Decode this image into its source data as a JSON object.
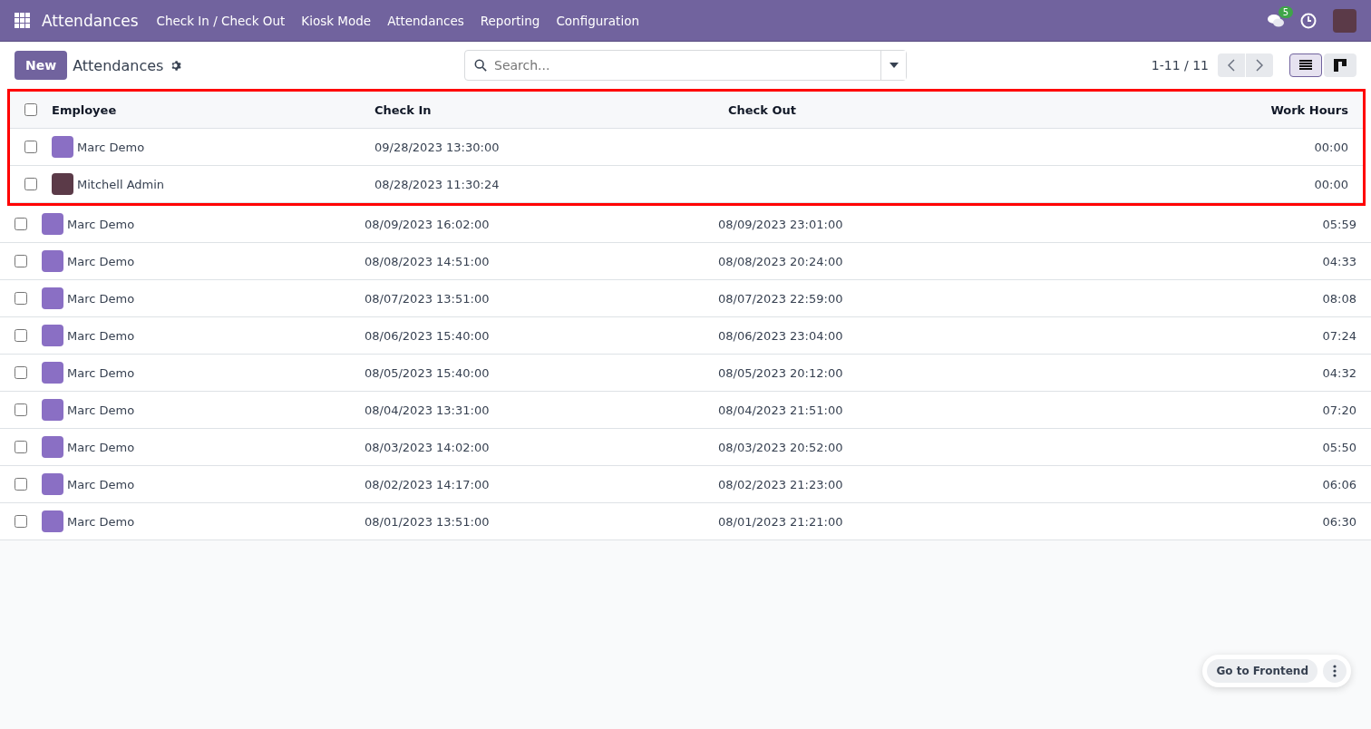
{
  "navbar": {
    "app_name": "Attendances",
    "menu": [
      "Check In / Check Out",
      "Kiosk Mode",
      "Attendances",
      "Reporting",
      "Configuration"
    ],
    "messages_badge": "5"
  },
  "control_panel": {
    "new_button": "New",
    "title": "Attendances",
    "search": {
      "placeholder": "Search..."
    },
    "pager": "1-11 / 11",
    "views": [
      {
        "kind": "list",
        "selected": true
      },
      {
        "kind": "kanban",
        "selected": false
      }
    ]
  },
  "table": {
    "columns": [
      "Employee",
      "Check In",
      "Check Out",
      "Work Hours"
    ],
    "rows": [
      {
        "employee": "Marc Demo",
        "color": "#8a6fc4",
        "check_in": "09/28/2023 13:30:00",
        "check_out": "",
        "work_hours": "00:00",
        "highlighted": true,
        "checked": false
      },
      {
        "employee": "Mitchell Admin",
        "color": "#5b3a48",
        "check_in": "08/28/2023 11:30:24",
        "check_out": "",
        "work_hours": "00:00",
        "highlighted": true,
        "checked": false
      },
      {
        "employee": "Marc Demo",
        "color": "#8a6fc4",
        "check_in": "08/09/2023 16:02:00",
        "check_out": "08/09/2023 23:01:00",
        "work_hours": "05:59",
        "highlighted": false,
        "checked": false
      },
      {
        "employee": "Marc Demo",
        "color": "#8a6fc4",
        "check_in": "08/08/2023 14:51:00",
        "check_out": "08/08/2023 20:24:00",
        "work_hours": "04:33",
        "highlighted": false,
        "checked": false
      },
      {
        "employee": "Marc Demo",
        "color": "#8a6fc4",
        "check_in": "08/07/2023 13:51:00",
        "check_out": "08/07/2023 22:59:00",
        "work_hours": "08:08",
        "highlighted": false,
        "checked": false
      },
      {
        "employee": "Marc Demo",
        "color": "#8a6fc4",
        "check_in": "08/06/2023 15:40:00",
        "check_out": "08/06/2023 23:04:00",
        "work_hours": "07:24",
        "highlighted": false,
        "checked": false
      },
      {
        "employee": "Marc Demo",
        "color": "#8a6fc4",
        "check_in": "08/05/2023 15:40:00",
        "check_out": "08/05/2023 20:12:00",
        "work_hours": "04:32",
        "highlighted": false,
        "checked": false
      },
      {
        "employee": "Marc Demo",
        "color": "#8a6fc4",
        "check_in": "08/04/2023 13:31:00",
        "check_out": "08/04/2023 21:51:00",
        "work_hours": "07:20",
        "highlighted": false,
        "checked": false
      },
      {
        "employee": "Marc Demo",
        "color": "#8a6fc4",
        "check_in": "08/03/2023 14:02:00",
        "check_out": "08/03/2023 20:52:00",
        "work_hours": "05:50",
        "highlighted": false,
        "checked": false
      },
      {
        "employee": "Marc Demo",
        "color": "#8a6fc4",
        "check_in": "08/02/2023 14:17:00",
        "check_out": "08/02/2023 21:23:00",
        "work_hours": "06:06",
        "highlighted": false,
        "checked": false
      },
      {
        "employee": "Marc Demo",
        "color": "#8a6fc4",
        "check_in": "08/01/2023 13:51:00",
        "check_out": "08/01/2023 21:21:00",
        "work_hours": "06:30",
        "highlighted": false,
        "checked": false
      }
    ]
  },
  "floating": {
    "button": "Go to Frontend"
  }
}
